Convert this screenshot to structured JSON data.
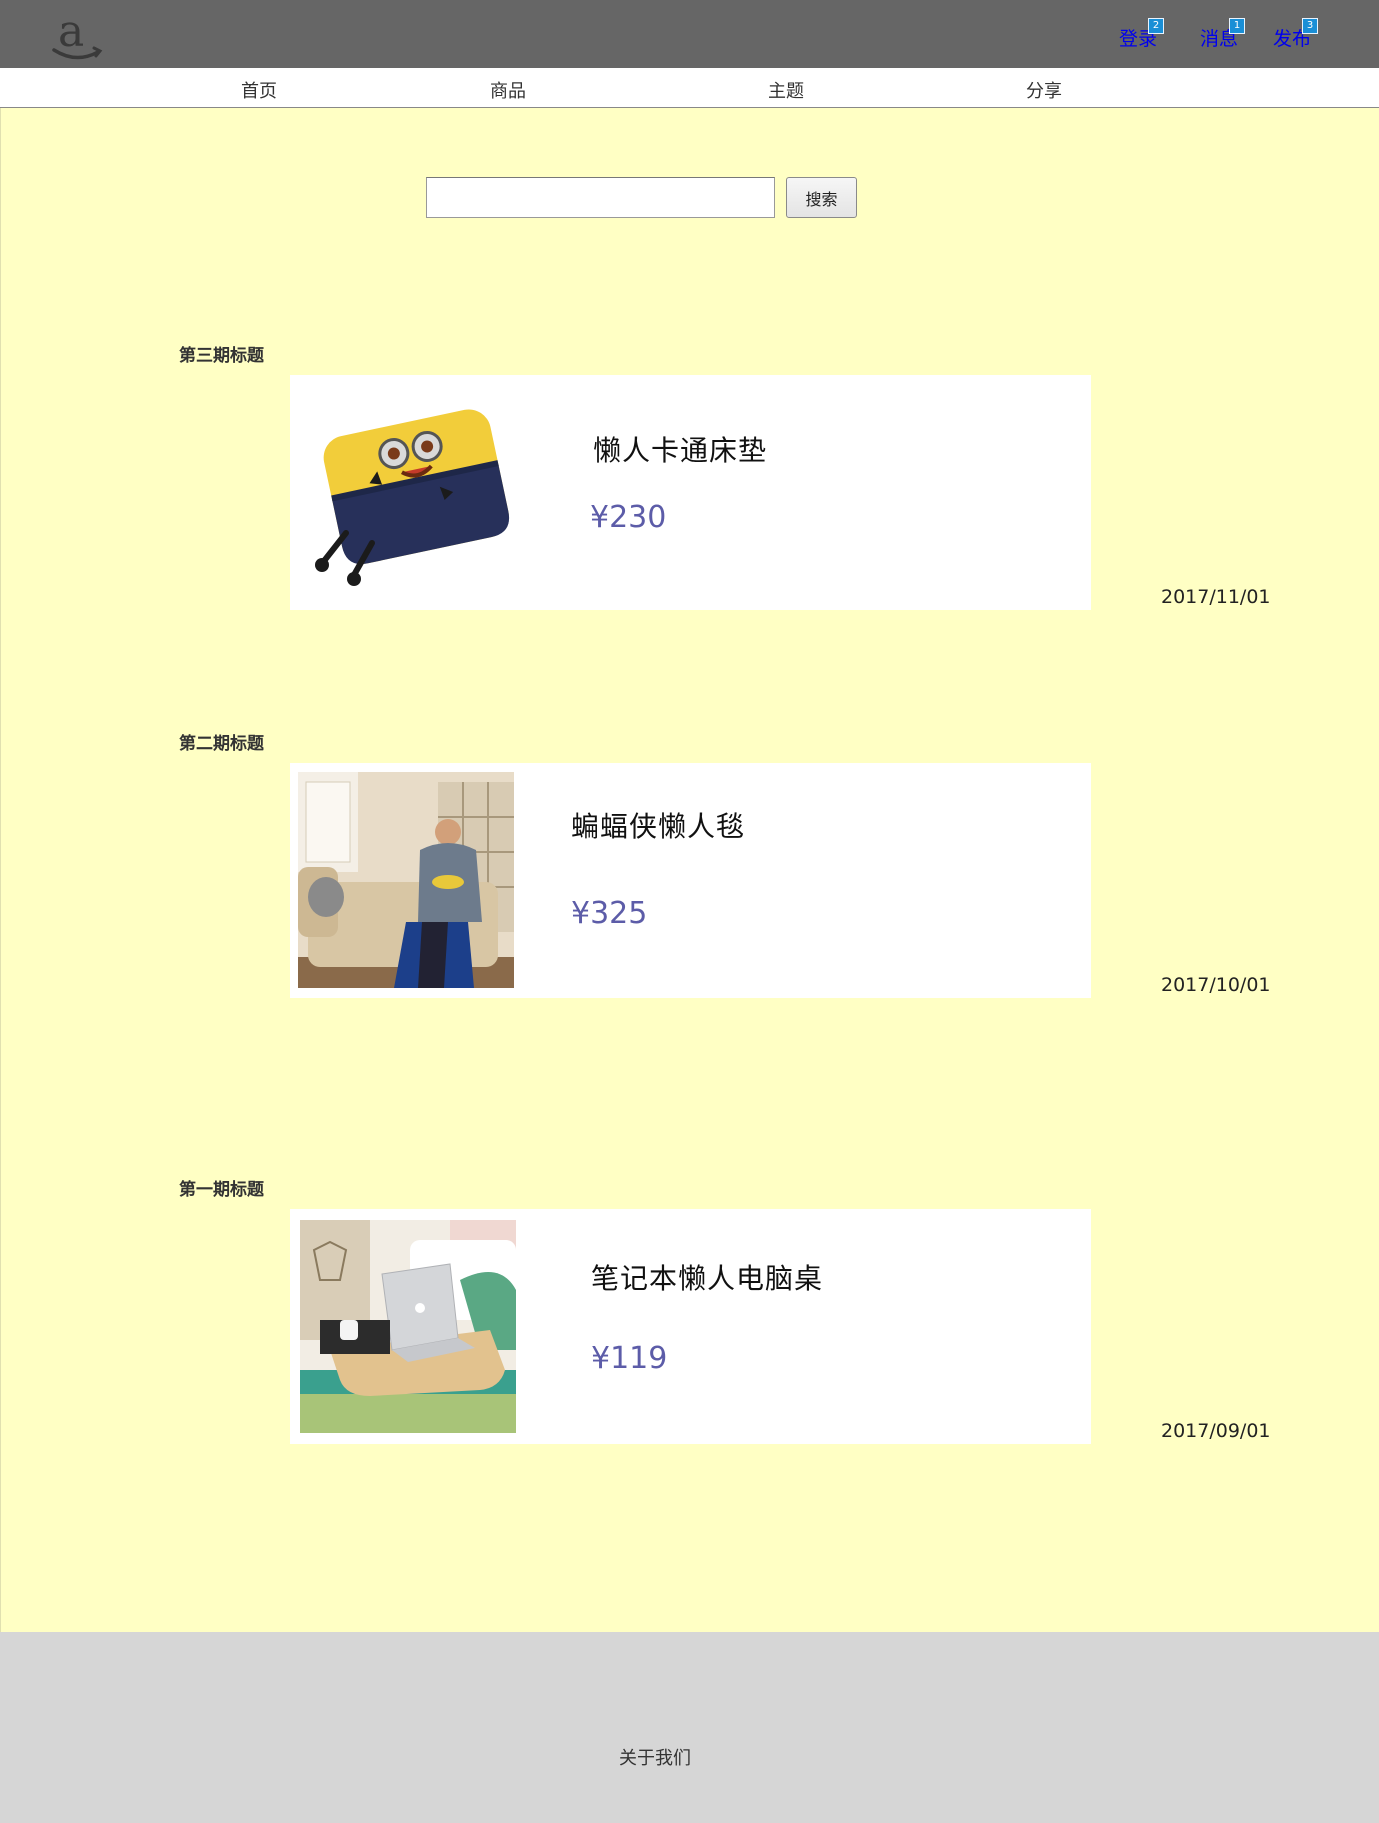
{
  "header": {
    "logo_icon": "amazon-a-logo-icon",
    "links": [
      {
        "label": "登录",
        "badge": "2"
      },
      {
        "label": "消息",
        "badge": "1"
      },
      {
        "label": "发布",
        "badge": "3"
      }
    ]
  },
  "nav": {
    "items": [
      "首页",
      "商品",
      "主题",
      "分享"
    ]
  },
  "search": {
    "value": "",
    "placeholder": "",
    "button_label": "搜索"
  },
  "issues": [
    {
      "title": "第三期标题",
      "product": "懒人卡通床垫",
      "price": "¥230",
      "date": "2017/11/01",
      "image": "minion-cartoon-mattress-image"
    },
    {
      "title": "第二期标题",
      "product": "蝙蝠侠懒人毯",
      "price": "¥325",
      "date": "2017/10/01",
      "image": "batman-blanket-on-sofa-image"
    },
    {
      "title": "第一期标题",
      "product": "笔记本懒人电脑桌",
      "price": "¥119",
      "date": "2017/09/01",
      "image": "laptop-bed-desk-image"
    }
  ],
  "footer": {
    "about_label": "关于我们"
  },
  "colors": {
    "header_bg": "#666666",
    "main_bg": "#ffffc4",
    "footer_bg": "#d6d6d6",
    "price": "#5c5ca8",
    "link": "#0000ee",
    "badge": "#1a8fd6"
  }
}
